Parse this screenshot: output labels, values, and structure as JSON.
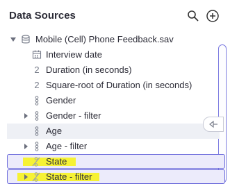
{
  "panel": {
    "title": "Data Sources"
  },
  "header": {
    "search_icon": "search-icon",
    "add_icon": "plus-circle-icon"
  },
  "tree": {
    "root": {
      "label": "Mobile (Cell) Phone Feedback.sav",
      "icon": "database-icon",
      "expanded": true
    },
    "items": [
      {
        "label": "Interview date",
        "icon": "calendar-icon",
        "glyph": ""
      },
      {
        "label": "Duration (in seconds)",
        "icon": "numeric-icon",
        "glyph": "2"
      },
      {
        "label": "Square-root of Duration (in seconds)",
        "icon": "numeric-icon",
        "glyph": "2"
      },
      {
        "label": "Gender",
        "icon": "categorical-icon",
        "glyph": ""
      },
      {
        "label": "Gender - filter",
        "icon": "categorical-icon",
        "glyph": "",
        "expandable": true
      },
      {
        "label": "Age",
        "icon": "categorical-icon",
        "glyph": ""
      },
      {
        "label": "Age - filter",
        "icon": "categorical-icon",
        "glyph": "",
        "expandable": true
      },
      {
        "label": "State",
        "icon": "hidden-variable-icon",
        "glyph": ""
      },
      {
        "label": "State - filter",
        "icon": "hidden-variable-icon",
        "glyph": "",
        "expandable": true
      }
    ]
  },
  "colors": {
    "selection_border": "#6b6adb",
    "highlight": "#f7f22a"
  }
}
